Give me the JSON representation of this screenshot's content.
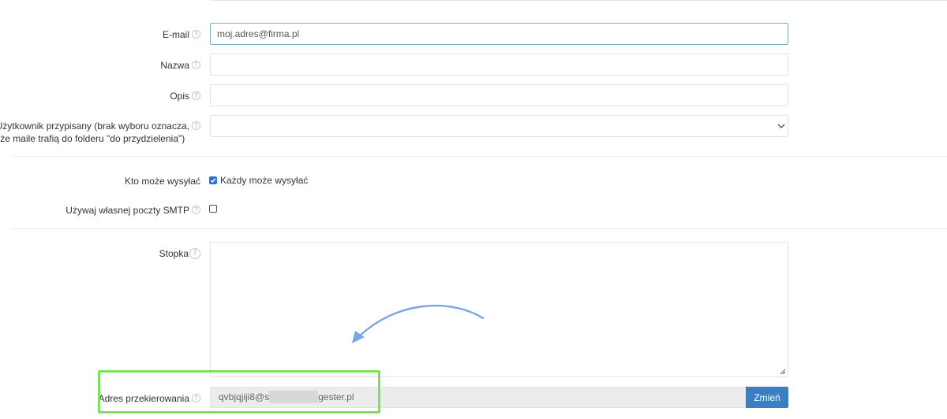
{
  "form": {
    "email": {
      "label": "E-mail",
      "value": "moj.adres@firma.pl"
    },
    "name": {
      "label": "Nazwa",
      "value": ""
    },
    "description": {
      "label": "Opis",
      "value": ""
    },
    "assigned_user": {
      "label_line1": "Użytkownik przypisany (brak wyboru oznacza,",
      "label_line2": "że maile trafią do folderu \"do przydzielenia\")",
      "selected": ""
    },
    "who_can_send": {
      "label": "Kto może wysyłać",
      "option_label": "Każdy może wysyłać",
      "checked": true
    },
    "own_smtp": {
      "label": "Używaj własnej poczty SMTP",
      "checked": false
    },
    "footer": {
      "label": "Stopka",
      "value": ""
    },
    "redirect": {
      "label": "Adres przekierowania",
      "value_prefix": "qvbjqjiji8@s",
      "value_suffix": "gester.pl",
      "change_label": "Zmień"
    }
  },
  "icons": {
    "help": "question-mark-icon",
    "chevron": "chevron-down-icon",
    "resize": "resize-handle-icon"
  },
  "help_glyph": "?",
  "colors": {
    "accent": "#3a7fc1",
    "highlight": "#7ee05c",
    "arrow": "#7aa6e8",
    "focus_border": "#7fb0c9"
  }
}
